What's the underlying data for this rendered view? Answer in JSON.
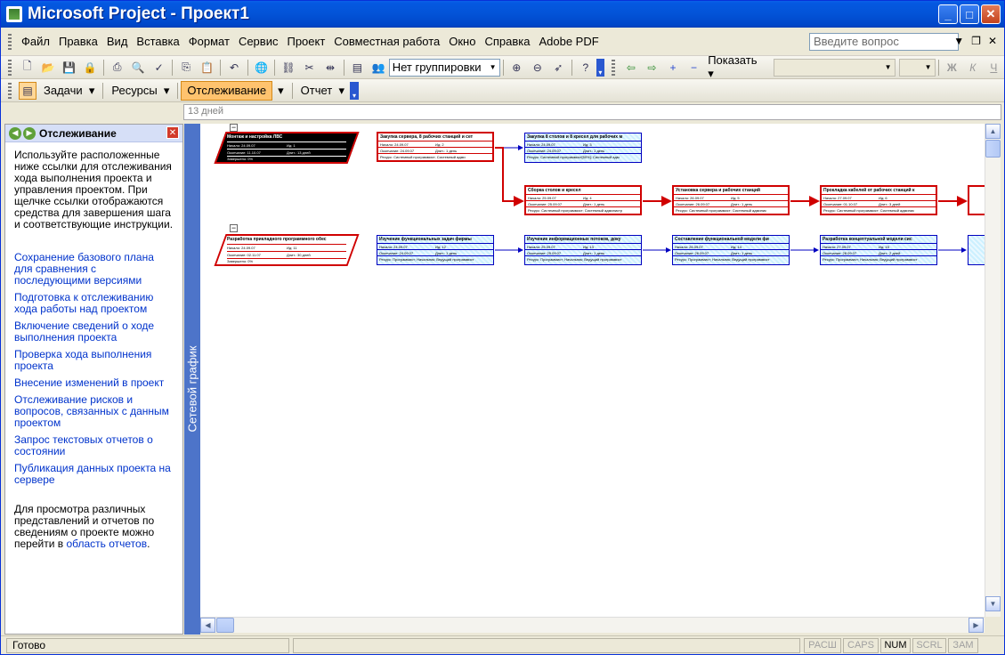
{
  "window": {
    "title": "Microsoft Project - Проект1"
  },
  "menu": {
    "items": [
      "Файл",
      "Правка",
      "Вид",
      "Вставка",
      "Формат",
      "Сервис",
      "Проект",
      "Совместная работа",
      "Окно",
      "Справка",
      "Adobe PDF"
    ],
    "ask_placeholder": "Введите вопрос"
  },
  "toolbar1": {
    "grouping": "Нет группировки",
    "show_label": "Показать"
  },
  "toolbar2": {
    "tasks": "Задачи",
    "resources": "Ресурсы",
    "tracking": "Отслеживание",
    "report": "Отчет"
  },
  "entry_bar": {
    "value": "13 дней"
  },
  "taskpane": {
    "title": "Отслеживание",
    "intro": "Используйте расположенные ниже ссылки для отслеживания хода выполнения проекта и управления проектом. При щелчке ссылки отображаются средства для завершения шага и соответствующие инструкции.",
    "links": [
      "Сохранение базового плана для сравнения с последующими версиями",
      "Подготовка к отслеживанию хода работы над проектом",
      "Включение сведений о ходе выполнения проекта",
      "Проверка хода выполнения проекта",
      "Внесение изменений в проект",
      "Отслеживание рисков и вопросов, связанных с данным проектом",
      "Запрос текстовых отчетов о состоянии",
      "Публикация данных проекта на сервере"
    ],
    "footer_text": "Для просмотра различных представлений и отчетов по сведениям о проекте можно перейти в",
    "footer_link": "область отчетов",
    "footer_end": "."
  },
  "view_bar": {
    "label": "Сетевой график"
  },
  "network": {
    "summaries": [
      {
        "title": "Монтаж и настройка ЛВС",
        "start": "Начало: 24.09.07",
        "id": "Ид: 1",
        "finish": "Окончание: 11.10.07",
        "duration": "Длит.: 13 дней",
        "complete": "Завершено: 0%"
      },
      {
        "title": "Разработка прикладного программного обес",
        "start": "Начало: 24.09.07",
        "id": "Ид: 11",
        "finish": "Окончание: 02.11.07",
        "duration": "Длит.: 30 дней",
        "complete": "Завершено: 0%"
      }
    ],
    "tasks": [
      {
        "title": "Закупка сервера, 8 рабочих станций и сет",
        "start": "Начало: 24.09.07",
        "id": "Ид: 2",
        "finish": "Окончание: 24.09.07",
        "duration": "Длит.: 1 день",
        "res": "Ресурс: Системный программист; Системный адми"
      },
      {
        "title": "Закупка 8 столов и 8 кресел для рабочих м",
        "start": "Начало: 24.09.07",
        "id": "Ид: 3",
        "finish": "Окончание: 24.09.07",
        "duration": "Длит.: 1 день",
        "res": "Ресурс: Системный программист[50%]; Системный адм"
      },
      {
        "title": "Сборка столов и кресел",
        "start": "Начало: 25.09.07",
        "id": "Ид: 4",
        "finish": "Окончание: 25.09.07",
        "duration": "Длит.: 1 день",
        "res": "Ресурс: Системный программист; Системный администр"
      },
      {
        "title": "Установка сервера и рабочих станций",
        "start": "Начало: 26.09.07",
        "id": "Ид: 5",
        "finish": "Окончание: 26.09.07",
        "duration": "Длит.: 1 день",
        "res": "Ресурс: Системный программист; Системный админис"
      },
      {
        "title": "Прокладка кабелей от рабочих станций к",
        "start": "Начало: 27.09.07",
        "id": "Ид: 6",
        "finish": "Окончание: 01.10.07",
        "duration": "Длит.: 3 дней",
        "res": "Ресурс: Системный программист; Системный админис"
      },
      {
        "title": "Изучение функциональных задач фирмы",
        "start": "Начало: 24.09.07",
        "id": "Ид: 12",
        "finish": "Окончание: 24.09.07",
        "duration": "Длит.: 1 день",
        "res": "Ресурс: Программист; Начальник; Ведущий программист"
      },
      {
        "title": "Изучение информационных потоков, доку",
        "start": "Начало: 25.09.07",
        "id": "Ид: 13",
        "finish": "Окончание: 25.09.07",
        "duration": "Длит.: 1 день",
        "res": "Ресурс: Программист; Начальник; Ведущий программист"
      },
      {
        "title": "Составление функциональной модели фи",
        "start": "Начало: 26.09.07",
        "id": "Ид: 14",
        "finish": "Окончание: 26.09.07",
        "duration": "Длит.: 1 день",
        "res": "Ресурс: Программист; Начальник; Ведущий программист"
      },
      {
        "title": "Разработка концептуальной модели сис",
        "start": "Начало: 27.09.07",
        "id": "Ид: 15",
        "finish": "Окончание: 28.09.07",
        "duration": "Длит.: 2 дней",
        "res": "Ресурс: Программист; Начальник; Ведущий программист"
      }
    ]
  },
  "status": {
    "ready": "Готово",
    "indicators": [
      "РАСШ",
      "CAPS",
      "NUM",
      "SCRL",
      "ЗАМ"
    ]
  }
}
